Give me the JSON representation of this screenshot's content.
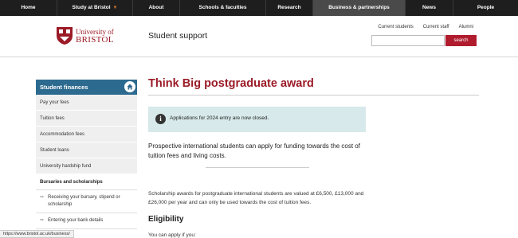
{
  "topnav": {
    "items": [
      {
        "label": "Home"
      },
      {
        "label": "Study at Bristol"
      },
      {
        "label": "About"
      },
      {
        "label": "Schools & faculties"
      },
      {
        "label": "Research"
      },
      {
        "label": "Business & partnerships"
      },
      {
        "label": "News"
      },
      {
        "label": "People"
      }
    ]
  },
  "header": {
    "logo_line1": "University of",
    "logo_line2": "BRISTOL",
    "site_title": "Student support",
    "util_links": [
      "Current students",
      "Current staff",
      "Alumni"
    ],
    "search_placeholder": "",
    "search_button": "search"
  },
  "sidebar": {
    "heading": "Student finances",
    "items": [
      {
        "label": "Pay your fees"
      },
      {
        "label": "Tuition fees"
      },
      {
        "label": "Accommodation fees"
      },
      {
        "label": "Student loans"
      },
      {
        "label": "University hardship fund"
      },
      {
        "label": "Bursaries and scholarships"
      }
    ],
    "subitems": [
      {
        "label": "Receiving your bursary, stipend or scholarship"
      },
      {
        "label": "Entering your bank details"
      }
    ]
  },
  "main": {
    "title": "Think Big postgraduate award",
    "notice": "Applications for 2024 entry are now closed.",
    "intro": "Prospective international students can apply for funding towards the cost of tuition fees and living costs.",
    "para": "Scholarship awards for postgraduate international students are valued at £6,500, £13,000 and £26,000 per year and can only be used towards the cost of tuition fees.",
    "eligibility_heading": "Eligibility",
    "partial_text": "You can apply if you:"
  },
  "status_bar": {
    "url": "https://www.bristol.ac.uk/business/"
  },
  "colors": {
    "brand_red": "#9b1b27",
    "nav_dark": "#1e1e1e",
    "sidebar_blue": "#2c6a8f",
    "notice_bg": "#d7e9ea",
    "search_red": "#b01c2e"
  }
}
